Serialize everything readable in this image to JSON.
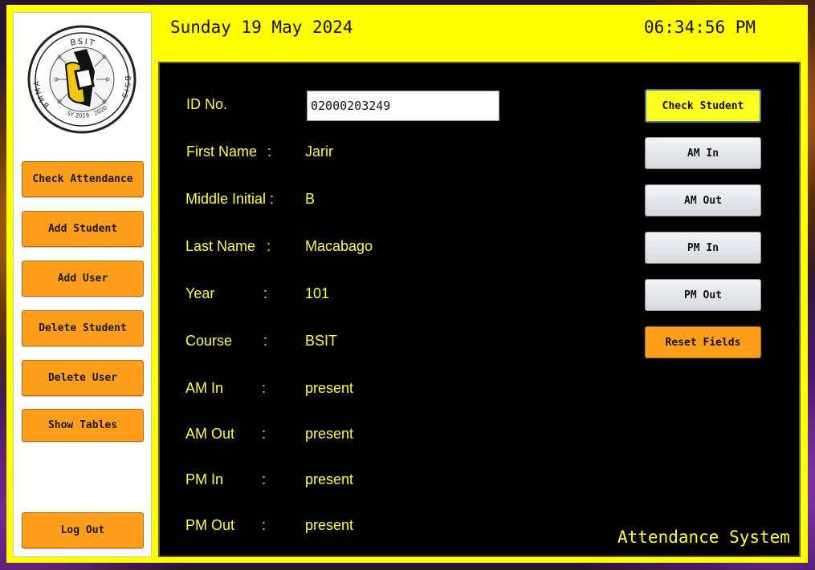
{
  "header": {
    "date": "Sunday 19 May 2024",
    "time": "06:34:56 PM"
  },
  "logo": {
    "top_text": "BSIT",
    "left_text": "BMMA",
    "right_text": "BSIS",
    "bottom_text": "SY 2019 - 2020"
  },
  "sidebar": {
    "buttons": [
      {
        "label": "Check Attendance"
      },
      {
        "label": "Add Student"
      },
      {
        "label": "Add User"
      },
      {
        "label": "Delete Student"
      },
      {
        "label": "Delete User"
      },
      {
        "label": "Show Tables"
      },
      {
        "label": "Log Out"
      }
    ]
  },
  "form": {
    "id_label": "ID No.",
    "id_value": "02000203249",
    "colon": ":",
    "fields": [
      {
        "label": "First Name",
        "value": "Jarir"
      },
      {
        "label": "Middle Initial",
        "value": "B"
      },
      {
        "label": "Last Name",
        "value": "Macabago"
      },
      {
        "label": "Year",
        "value": "101"
      },
      {
        "label": "Course",
        "value": "BSIT"
      },
      {
        "label": "AM In",
        "value": "present"
      },
      {
        "label": "AM Out",
        "value": "present"
      },
      {
        "label": "PM In",
        "value": "present"
      },
      {
        "label": "PM Out",
        "value": "present"
      }
    ]
  },
  "actions": {
    "check_student": "Check Student",
    "am_in": "AM In",
    "am_out": "AM Out",
    "pm_in": "PM In",
    "pm_out": "PM Out",
    "reset": "Reset Fields"
  },
  "footer": {
    "title": "Attendance System"
  },
  "colors": {
    "frame": "#ffff00",
    "panel": "#000000",
    "text_accent": "#ffff33",
    "button_orange": "#ff9e1a"
  }
}
